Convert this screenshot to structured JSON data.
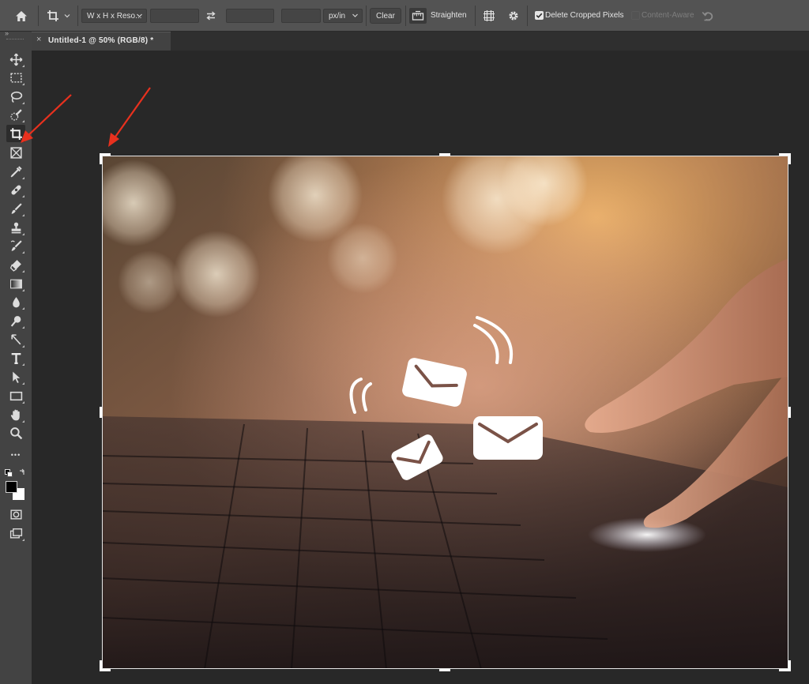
{
  "options_bar": {
    "home_icon": "home-icon",
    "crop_tool_icon": "crop-icon",
    "ratio_preset": "W x H x Reso...",
    "width_value": "",
    "height_value": "",
    "resolution_value": "",
    "resolution_unit": "px/in",
    "clear_label": "Clear",
    "straighten_label": "Straighten",
    "overlay_icon": "grid-overlay-icon",
    "settings_icon": "gear-icon",
    "delete_cropped_label": "Delete Cropped Pixels",
    "delete_cropped_checked": true,
    "content_aware_label": "Content-Aware",
    "content_aware_checked": false,
    "reset_icon": "undo-icon"
  },
  "document_tab": {
    "close_glyph": "×",
    "title": "Untitled-1 @ 50% (RGB/8) *"
  },
  "toolbar": {
    "active_tool": "crop-tool",
    "more_glyph": "•••",
    "foreground_color": "#000000",
    "background_color": "#ffffff",
    "tools": [
      "move-tool",
      "marquee-tool",
      "lasso-tool",
      "quick-selection-tool",
      "crop-tool",
      "frame-tool",
      "eyedropper-tool",
      "healing-brush-tool",
      "brush-tool",
      "clone-stamp-tool",
      "history-brush-tool",
      "eraser-tool",
      "gradient-tool",
      "blur-tool",
      "dodge-tool",
      "pen-tool",
      "type-tool",
      "path-selection-tool",
      "rectangle-tool",
      "hand-tool",
      "zoom-tool"
    ]
  },
  "annotations": {
    "arrow_color": "#e8311e"
  },
  "colors": {
    "panel": "#535353",
    "toolbar": "#434343",
    "workspace": "#282828",
    "accent_checkbox": "#e6e6e6"
  }
}
